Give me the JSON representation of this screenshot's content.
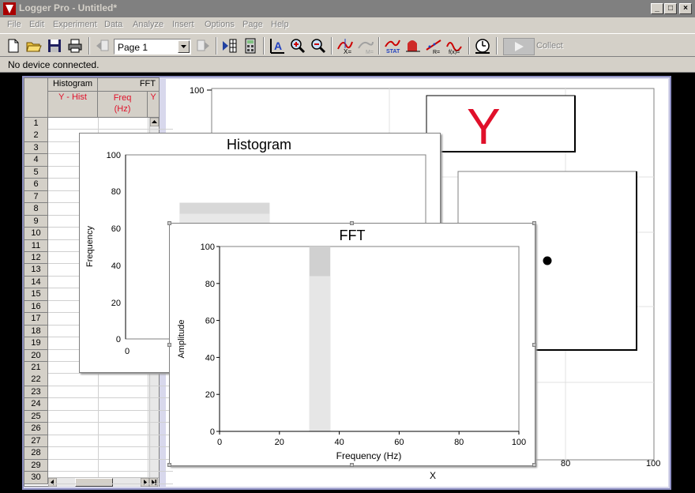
{
  "window": {
    "title": "Logger Pro - Untitled*"
  },
  "menu": [
    "File",
    "Edit",
    "Experiment",
    "Data",
    "Analyze",
    "Insert",
    "Options",
    "Page",
    "Help"
  ],
  "toolbar": {
    "page_select_value": "Page 1",
    "collect_label": "Collect"
  },
  "status": {
    "text": "No device connected."
  },
  "table": {
    "groups": [
      "Histogram",
      "FFT"
    ],
    "columns": [
      {
        "name": "Y - Hist",
        "unit": ""
      },
      {
        "name": "Freq",
        "unit": "(Hz)"
      },
      {
        "name": "Y",
        "unit": ""
      }
    ],
    "rows": [
      "1",
      "2",
      "3",
      "4",
      "5",
      "6",
      "7",
      "8",
      "9",
      "10",
      "11",
      "12",
      "13",
      "14",
      "15",
      "16",
      "17",
      "18",
      "19",
      "20",
      "21",
      "22",
      "23",
      "24",
      "25",
      "26",
      "27",
      "28",
      "29",
      "30"
    ]
  },
  "main_graph": {
    "y_label": "Y",
    "x_label": "X",
    "y_top_tick": "100",
    "x_ticks": [
      "80",
      "100"
    ],
    "point": {
      "x": 75,
      "y": 60
    },
    "colors": {
      "y_label": "#e0102a",
      "point": "#000000"
    }
  },
  "chart_data": [
    {
      "type": "bar",
      "title": "Histogram",
      "ylabel": "Frequency",
      "xlabel": "",
      "ylim": [
        0,
        100
      ],
      "yticks": [
        "0",
        "20",
        "40",
        "60",
        "80",
        "100"
      ],
      "xticks": [
        "0"
      ],
      "bars": [
        {
          "x0": 18,
          "x1": 48,
          "values": [
            74,
            68
          ],
          "colors": [
            "#d8d8d8",
            "#e8e8e8"
          ]
        }
      ]
    },
    {
      "type": "bar",
      "title": "FFT",
      "ylabel": "Amplitude",
      "xlabel": "Frequency (Hz)",
      "xlim": [
        0,
        100
      ],
      "ylim": [
        0,
        100
      ],
      "xticks": [
        "0",
        "20",
        "40",
        "60",
        "80",
        "100"
      ],
      "yticks": [
        "0",
        "20",
        "40",
        "60",
        "80",
        "100"
      ],
      "bars": [
        {
          "x0": 30,
          "x1": 37,
          "values": [
            100,
            84
          ],
          "colors": [
            "#d0d0d0",
            "#e6e6e6"
          ]
        }
      ]
    }
  ]
}
